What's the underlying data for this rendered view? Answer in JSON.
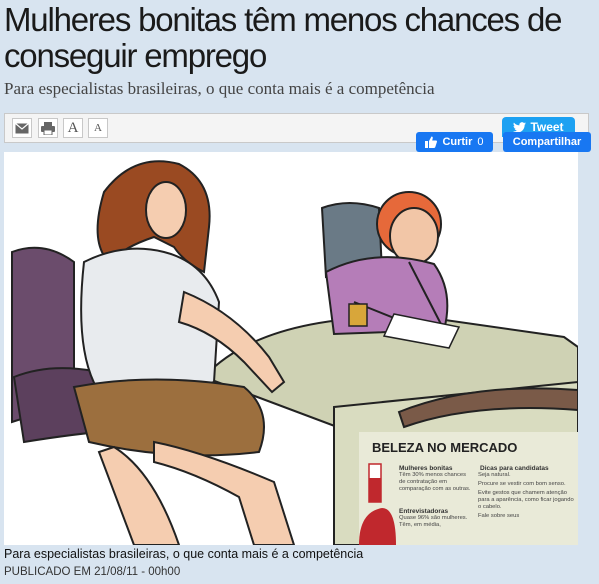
{
  "article": {
    "title": "Mulheres bonitas têm menos chances de conseguir emprego",
    "subtitle": "Para especialistas brasileiras, o que conta mais é a competência",
    "caption": "Para especialistas brasileiras, o que conta mais é a competência",
    "published": "PUBLICADO EM 21/08/11 - 00h00"
  },
  "toolbar": {
    "email_icon": "envelope-icon",
    "print_icon": "printer-icon",
    "font_increase_label": "A",
    "font_decrease_label": "A"
  },
  "social": {
    "tweet_label": "Tweet",
    "like_label": "Curtir",
    "like_count": "0",
    "share_label": "Compartilhar",
    "colors": {
      "twitter": "#1da1f2",
      "facebook": "#1877f2"
    }
  },
  "infographic": {
    "title": "BELEZA NO MERCADO",
    "section_left_1": "Mulheres bonitas",
    "text_left_1": "Têm 30% menos chances de contratação em comparação com as outras.",
    "section_left_2": "Entrevistadoras",
    "text_left_2": "Quase 96% são mulheres. Têm, em média,",
    "section_right": "Dicas para candidatas",
    "tips": [
      "Seja natural.",
      "Procure se vestir com bom senso.",
      "Evite gestos que chamem atenção para a aparência, como ficar jogando o cabelo.",
      "Fale sobre seus"
    ]
  }
}
